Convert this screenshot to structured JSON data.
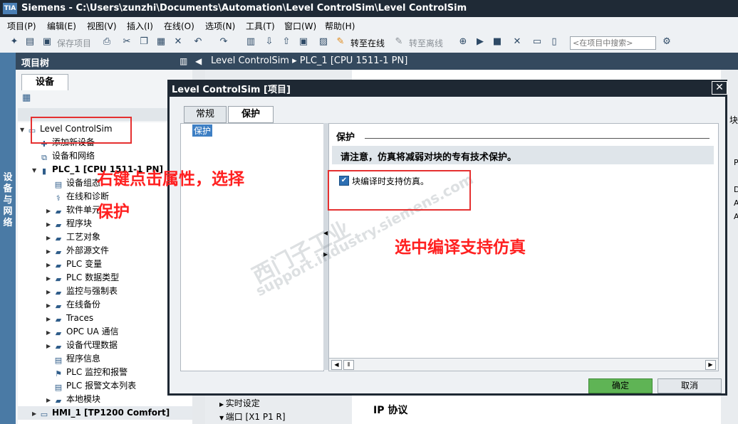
{
  "window": {
    "logo": "TIA",
    "title": "Siemens  -  C:\\Users\\zunzhi\\Documents\\Automation\\Level ControlSim\\Level ControlSim"
  },
  "menu": [
    "项目(P)",
    "编辑(E)",
    "视图(V)",
    "插入(I)",
    "在线(O)",
    "选项(N)",
    "工具(T)",
    "窗口(W)",
    "帮助(H)"
  ],
  "toolbar": {
    "save_project": "保存项目",
    "go_online": "转至在线",
    "go_offline": "转至离线",
    "search_placeholder": "<在项目中搜索>"
  },
  "side_strip": "设备与网络",
  "project_tree": {
    "title": "项目树",
    "tab": "设备",
    "items": [
      "Level ControlSim",
      "添加新设备",
      "设备和网络",
      "PLC_1 [CPU 1511-1 PN]",
      "设备组态",
      "在线和诊断",
      "软件单元",
      "程序块",
      "工艺对象",
      "外部源文件",
      "PLC 变量",
      "PLC 数据类型",
      "监控与强制表",
      "在线备份",
      "Traces",
      "OPC UA 通信",
      "设备代理数据",
      "程序信息",
      "PLC 监控和报警",
      "PLC 报警文本列表",
      "本地模块",
      "HMI_1 [TP1200 Comfort]"
    ]
  },
  "editor": {
    "breadcrumb": "Level ControlSim  ▸  PLC_1 [CPU 1511-1 PN]",
    "bg_items": [
      "实时设定",
      "端口 [X1 P1 R]"
    ],
    "ip_label": "IP 协议",
    "side_letters": [
      "块",
      "P",
      "D",
      "A",
      "A"
    ]
  },
  "dialog": {
    "title": "Level ControlSim [项目]",
    "tabs": [
      "常规",
      "保护"
    ],
    "nav_selected": "保护",
    "section": "保护",
    "notice": "请注意，仿真将减弱对块的专有技术保护。",
    "checkbox_label": "块编译时支持仿真。",
    "ok": "确定",
    "cancel": "取消"
  },
  "annotations": {
    "left_line1": "右键点击属性，选择",
    "left_line2": "保护",
    "right": "选中编译支持仿真"
  },
  "watermark": {
    "line1": "西门子工业",
    "line2": "support.industry.siemens.com"
  },
  "colors": {
    "annotation_red": "#ff2020",
    "ok_green": "#5fb455",
    "title_dark": "#1f2a36"
  }
}
